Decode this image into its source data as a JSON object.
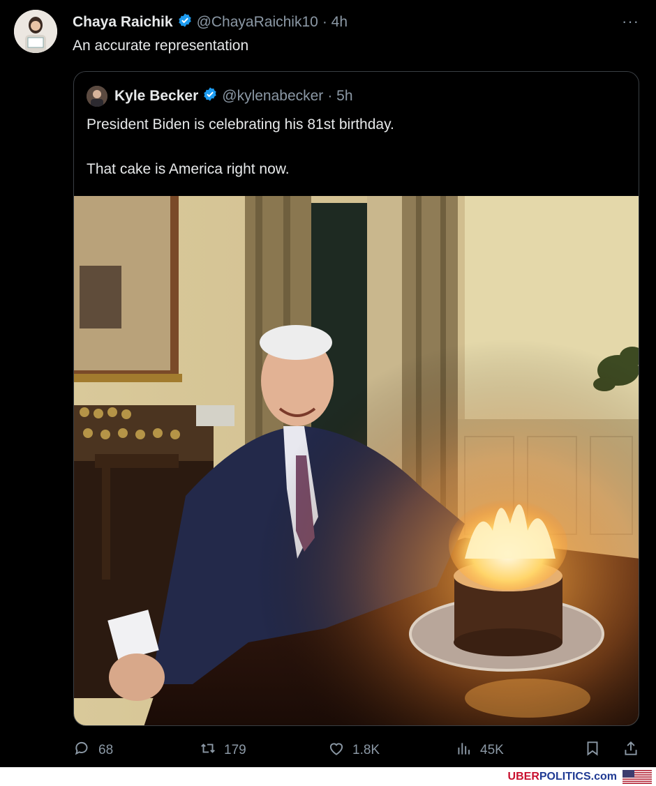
{
  "tweet": {
    "author_name": "Chaya Raichik",
    "author_handle": "@ChayaRaichik10",
    "time": "· 4h",
    "text": "An accurate representation",
    "more_label": "···"
  },
  "quote": {
    "author_name": "Kyle Becker",
    "author_handle": "@kylenabecker",
    "time": "· 5h",
    "text": "President Biden is celebrating his 81st birthday.\n\nThat cake is America right now."
  },
  "actions": {
    "replies": "68",
    "reposts": "179",
    "likes": "1.8K",
    "views": "45K"
  },
  "footer": {
    "brand_a": "UBER",
    "brand_b": "POLITICS",
    "brand_c": ".com"
  },
  "colors": {
    "verified": "#1d9bf0",
    "muted": "#8b98a5",
    "brand_red": "#c8102e",
    "brand_blue": "#1f3a93"
  },
  "icons": [
    "verified-icon",
    "more-icon",
    "reply-icon",
    "repost-icon",
    "like-icon",
    "views-icon",
    "bookmark-icon",
    "share-icon",
    "us-flag-icon"
  ]
}
